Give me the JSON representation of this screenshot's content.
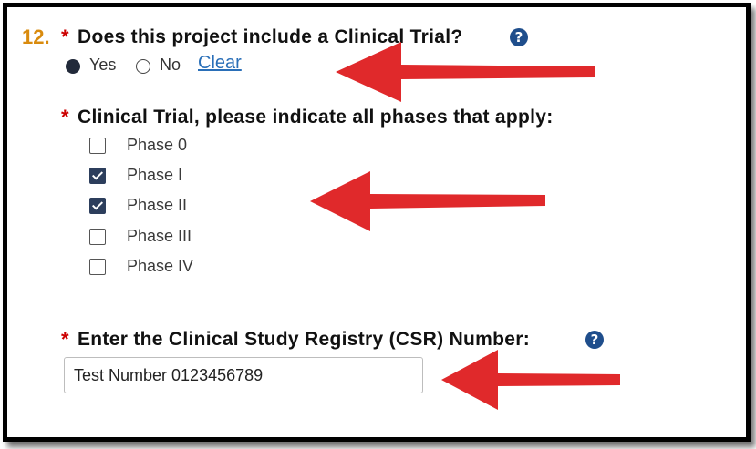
{
  "question": {
    "number": "12.",
    "required_mark": "*",
    "text": "Does this project include a Clinical Trial?",
    "help_icon": "?",
    "options": [
      {
        "label": "Yes",
        "selected": true
      },
      {
        "label": "No",
        "selected": false
      }
    ],
    "clear_label": "Clear"
  },
  "phases": {
    "required_mark": "*",
    "text": "Clinical Trial, please indicate all phases that apply:",
    "items": [
      {
        "label": "Phase 0",
        "checked": false
      },
      {
        "label": "Phase I",
        "checked": true
      },
      {
        "label": "Phase II",
        "checked": true
      },
      {
        "label": "Phase III",
        "checked": false
      },
      {
        "label": "Phase IV",
        "checked": false
      }
    ]
  },
  "csr": {
    "required_mark": "*",
    "text": "Enter the Clinical Study Registry (CSR) Number:",
    "help_icon": "?",
    "value": "Test Number 0123456789"
  },
  "colors": {
    "question_number": "#d98b0e",
    "required": "#cc0000",
    "help_icon_bg": "#1f4e8c",
    "link": "#2a6fb8",
    "annotation_arrow": "#e0292b"
  },
  "annotations": [
    "arrow-icon",
    "arrow-icon",
    "arrow-icon"
  ]
}
